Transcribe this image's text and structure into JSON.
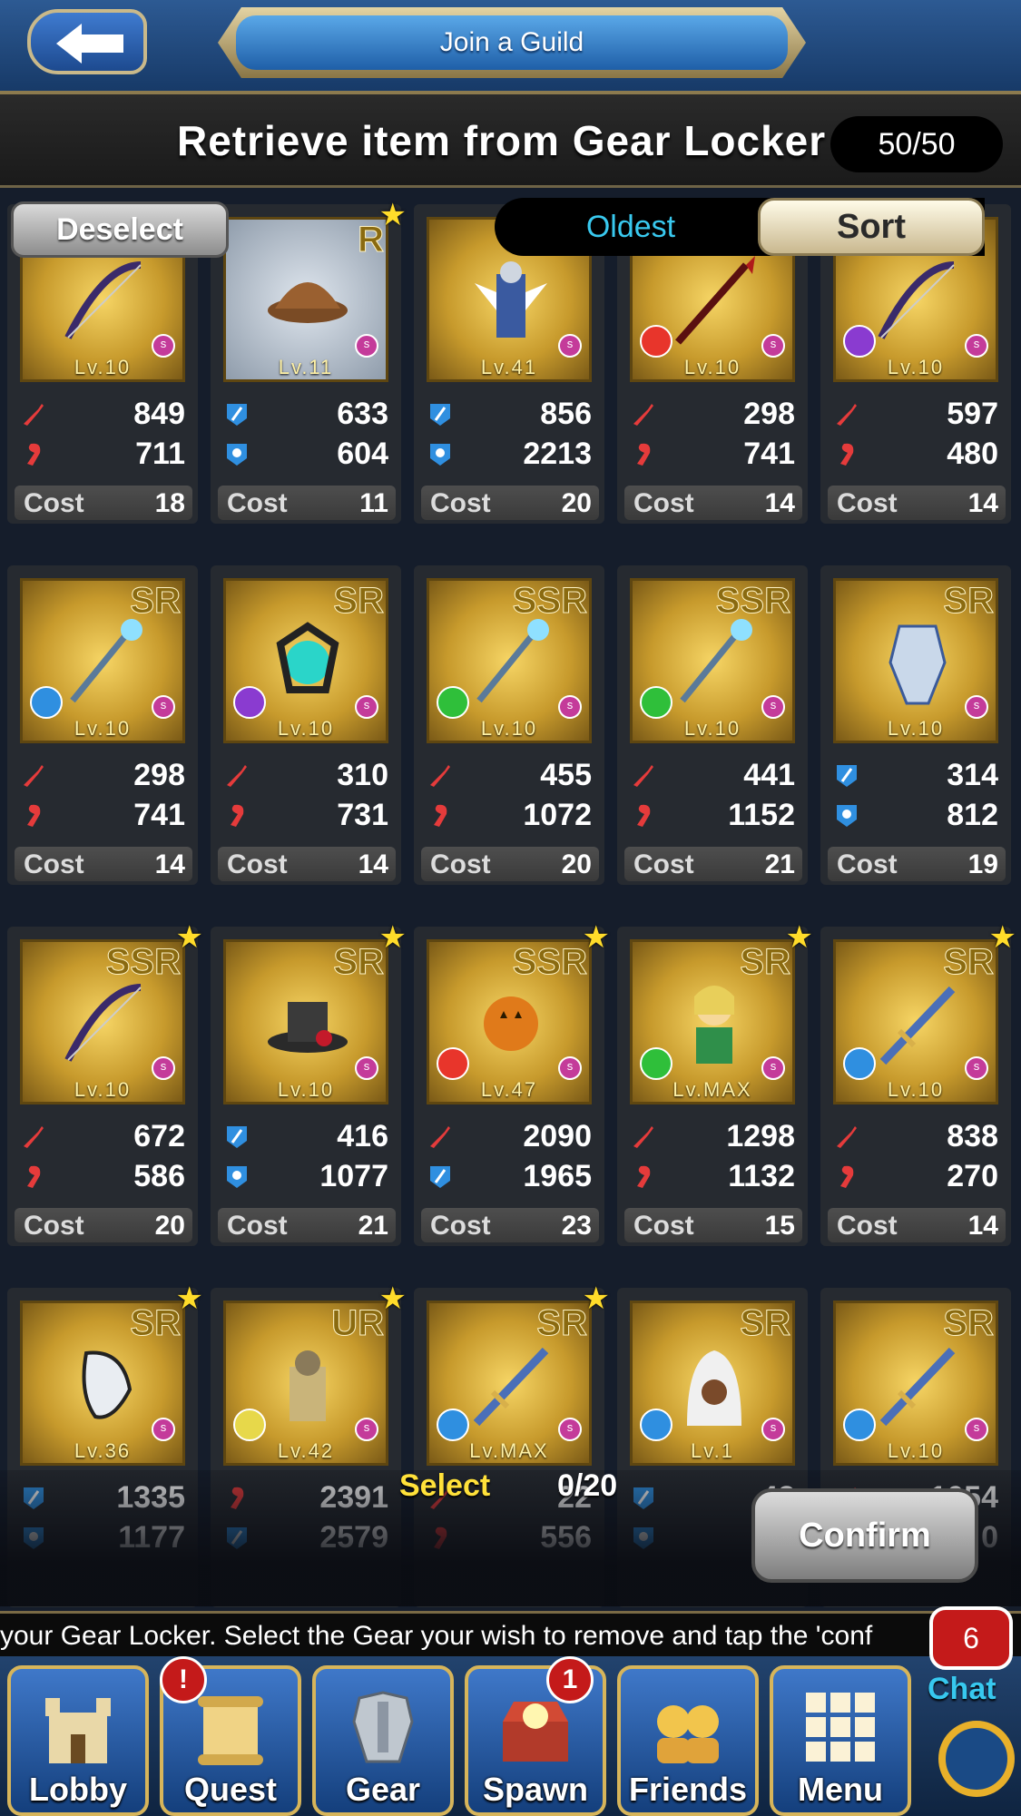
{
  "top_bar": {
    "back_icon": "arrow-left-icon",
    "guild_label": "Join a Guild"
  },
  "header": {
    "title": "Retrieve item from Gear Locker",
    "count": "50/50"
  },
  "controls": {
    "deselect_label": "Deselect",
    "sort_mode": "Oldest",
    "sort_label": "Sort"
  },
  "cards": [
    {
      "rarity": "",
      "level": "Lv.10",
      "element": "none",
      "star": false,
      "art": "bow",
      "stat1_type": "attack",
      "stat1": "849",
      "stat2_type": "heal",
      "stat2": "711",
      "cost_label": "Cost",
      "cost": "18"
    },
    {
      "rarity": "R",
      "level": "Lv.11",
      "element": "none",
      "star": true,
      "art": "cap",
      "stat1_type": "defense",
      "stat1": "633",
      "stat2_type": "magic-defense",
      "stat2": "604",
      "cost_label": "Cost",
      "cost": "11"
    },
    {
      "rarity": "",
      "level": "Lv.41",
      "element": "none",
      "star": false,
      "art": "knight",
      "stat1_type": "defense",
      "stat1": "856",
      "stat2_type": "magic-defense",
      "stat2": "2213",
      "cost_label": "Cost",
      "cost": "20"
    },
    {
      "rarity": "",
      "level": "Lv.10",
      "element": "fire",
      "star": false,
      "art": "spear",
      "stat1_type": "attack",
      "stat1": "298",
      "stat2_type": "heal",
      "stat2": "741",
      "cost_label": "Cost",
      "cost": "14"
    },
    {
      "rarity": "",
      "level": "Lv.10",
      "element": "dark",
      "star": false,
      "art": "bow",
      "stat1_type": "attack",
      "stat1": "597",
      "stat2_type": "heal",
      "stat2": "480",
      "cost_label": "Cost",
      "cost": "14"
    },
    {
      "rarity": "SR",
      "level": "Lv.10",
      "element": "water",
      "star": false,
      "art": "staff",
      "stat1_type": "attack",
      "stat1": "298",
      "stat2_type": "heal",
      "stat2": "741",
      "cost_label": "Cost",
      "cost": "14"
    },
    {
      "rarity": "SR",
      "level": "Lv.10",
      "element": "dark",
      "star": false,
      "art": "orb",
      "stat1_type": "attack",
      "stat1": "310",
      "stat2_type": "heal",
      "stat2": "731",
      "cost_label": "Cost",
      "cost": "14"
    },
    {
      "rarity": "SSR",
      "level": "Lv.10",
      "element": "wind",
      "star": false,
      "art": "staff",
      "stat1_type": "attack",
      "stat1": "455",
      "stat2_type": "heal",
      "stat2": "1072",
      "cost_label": "Cost",
      "cost": "20"
    },
    {
      "rarity": "SSR",
      "level": "Lv.10",
      "element": "wind",
      "star": false,
      "art": "staff",
      "stat1_type": "attack",
      "stat1": "441",
      "stat2_type": "heal",
      "stat2": "1152",
      "cost_label": "Cost",
      "cost": "21"
    },
    {
      "rarity": "SR",
      "level": "Lv.10",
      "element": "none",
      "star": false,
      "art": "armor",
      "stat1_type": "defense",
      "stat1": "314",
      "stat2_type": "magic-defense",
      "stat2": "812",
      "cost_label": "Cost",
      "cost": "19"
    },
    {
      "rarity": "SSR",
      "level": "Lv.10",
      "element": "none",
      "star": true,
      "art": "bow",
      "stat1_type": "attack",
      "stat1": "672",
      "stat2_type": "heal",
      "stat2": "586",
      "cost_label": "Cost",
      "cost": "20"
    },
    {
      "rarity": "SR",
      "level": "Lv.10",
      "element": "none",
      "star": true,
      "art": "hat",
      "stat1_type": "defense",
      "stat1": "416",
      "stat2_type": "magic-defense",
      "stat2": "1077",
      "cost_label": "Cost",
      "cost": "21"
    },
    {
      "rarity": "SSR",
      "level": "Lv.47",
      "element": "fire",
      "star": true,
      "art": "pumpkin",
      "stat1_type": "attack",
      "stat1": "2090",
      "stat2_type": "defense",
      "stat2": "1965",
      "cost_label": "Cost",
      "cost": "23"
    },
    {
      "rarity": "SR",
      "level": "Lv.MAX",
      "element": "wind",
      "star": true,
      "art": "hero",
      "stat1_type": "attack",
      "stat1": "1298",
      "stat2_type": "heal",
      "stat2": "1132",
      "cost_label": "Cost",
      "cost": "15"
    },
    {
      "rarity": "SR",
      "level": "Lv.10",
      "element": "water",
      "star": true,
      "art": "sword",
      "stat1_type": "attack",
      "stat1": "838",
      "stat2_type": "heal",
      "stat2": "270",
      "cost_label": "Cost",
      "cost": "14"
    },
    {
      "rarity": "SR",
      "level": "Lv.36",
      "element": "none",
      "star": true,
      "art": "mask",
      "stat1_type": "defense",
      "stat1": "1335",
      "stat2_type": "magic-defense",
      "stat2": "1177",
      "cost_label": "",
      "cost": ""
    },
    {
      "rarity": "UR",
      "level": "Lv.42",
      "element": "light",
      "star": true,
      "art": "warrior",
      "stat1_type": "heal",
      "stat1": "2391",
      "stat2_type": "defense",
      "stat2": "2579",
      "cost_label": "",
      "cost": ""
    },
    {
      "rarity": "SR",
      "level": "Lv.MAX",
      "element": "water",
      "star": true,
      "art": "sword",
      "stat1_type": "attack",
      "stat1": "22",
      "stat2_type": "heal",
      "stat2": "556",
      "cost_label": "",
      "cost": ""
    },
    {
      "rarity": "SR",
      "level": "Lv.1",
      "element": "water",
      "star": false,
      "art": "hooded",
      "stat1_type": "defense",
      "stat1": "42",
      "stat2_type": "magic-defense",
      "stat2": "5",
      "cost_label": "",
      "cost": ""
    },
    {
      "rarity": "SR",
      "level": "Lv.10",
      "element": "water",
      "star": false,
      "art": "sword",
      "stat1_type": "attack",
      "stat1": "1054",
      "stat2_type": "heal",
      "stat2": "0",
      "cost_label": "",
      "cost": ""
    }
  ],
  "selection": {
    "label": "Select",
    "count": "0/20",
    "confirm_label": "Confirm"
  },
  "ticker": {
    "text": "your Gear Locker. Select the Gear your wish to remove and tap the 'conf"
  },
  "nav": [
    {
      "label": "Lobby",
      "icon": "castle-icon",
      "badge": ""
    },
    {
      "label": "Quest",
      "icon": "scroll-icon",
      "badge": "!"
    },
    {
      "label": "Gear",
      "icon": "armor-icon",
      "badge": ""
    },
    {
      "label": "Spawn",
      "icon": "treasure-chest-icon",
      "badge": "1"
    },
    {
      "label": "Friends",
      "icon": "friends-icon",
      "badge": ""
    },
    {
      "label": "Menu",
      "icon": "grid-menu-icon",
      "badge": ""
    }
  ],
  "chat": {
    "label": "Chat",
    "badge": "6",
    "icon": "refresh-icon"
  },
  "colors": {
    "attack": "#e53b3b",
    "defense": "#2f8fe0",
    "fire": "#e8352b",
    "water": "#2f8fe0",
    "wind": "#2fbf3a",
    "dark": "#8a3bd0",
    "light": "#e7d84a"
  }
}
